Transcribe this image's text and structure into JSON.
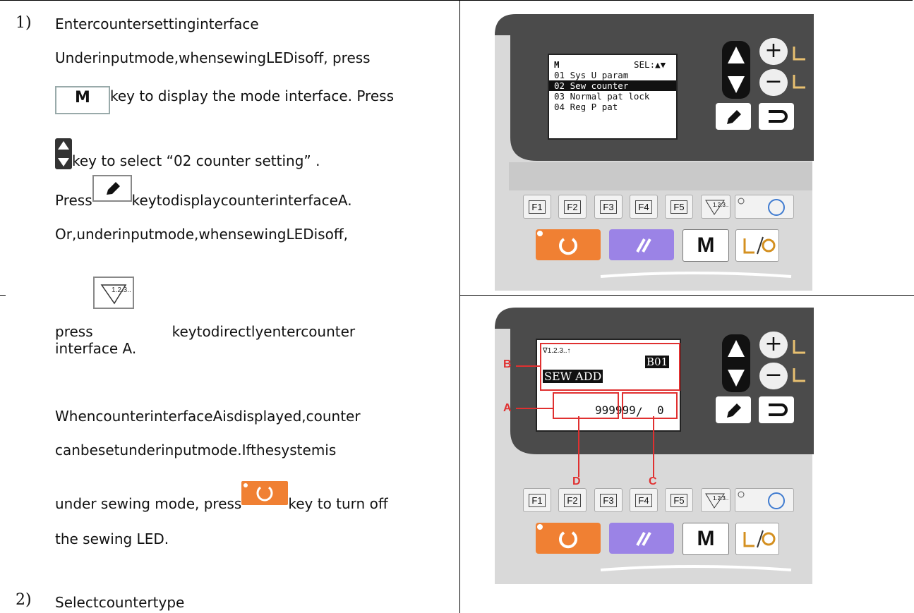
{
  "steps": [
    {
      "num": "1)",
      "title": "Entercountersettinginterface"
    },
    {
      "num": "2)",
      "title": "Selectcountertype"
    }
  ],
  "text": {
    "l1": "Underinputmode,whensewingLEDisoff, press",
    "l2": "key to display the mode interface. Press",
    "l3": "key to select  “02 counter setting” .",
    "l4a": "Press",
    "l4b": "keytodisplaycounterinterfaceA.",
    "l5": "Or,underinputmode,whensewingLEDisoff,",
    "l6a": "press",
    "l6b": "keytodirectlyentercounter",
    "l7": "interface A.",
    "l8": "WhencounterinterfaceAisdisplayed,counter",
    "l9": "canbesetunderinputmode.Ifthesystemis",
    "l10a": "under sewing mode, press",
    "l10b": "key to turn off",
    "l11": "the sewing LED."
  },
  "inline_keys": {
    "m_key": "M",
    "counter_key": "1.2.3.."
  },
  "panel1": {
    "lcd_header": "M",
    "lcd_sel": "SEL:▲▼",
    "lcd_rows": [
      "01 Sys U param",
      "02 Sew counter",
      "03 Normal pat lock",
      "04 Reg P pat"
    ]
  },
  "panel2": {
    "lcd_icon": "∇1.2.3..↑",
    "lcd_code": "B01",
    "lcd_title": "SEW ADD",
    "count_left": "999999",
    "slash": "/",
    "count_right": "0",
    "labels": {
      "a": "A",
      "b": "B",
      "c": "C",
      "d": "D"
    }
  },
  "panel_keys": {
    "f1": "F1",
    "f2": "F2",
    "f3": "F3",
    "f4": "F4",
    "f5": "F5",
    "counter": "1.2.3..",
    "m": "M",
    "plus": "+",
    "minus": "−"
  },
  "colors": {
    "orange": "#f08033",
    "purple": "#9b83e6",
    "red": "#e03030"
  }
}
